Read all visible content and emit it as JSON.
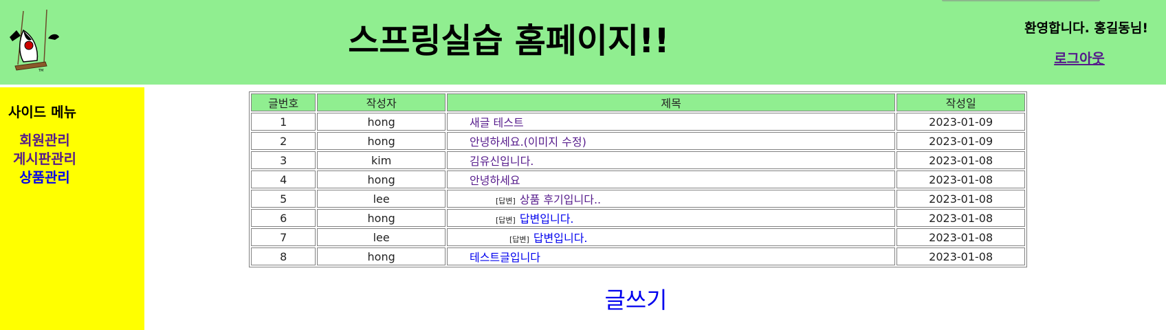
{
  "header": {
    "site_title": "스프링실습 홈페이지!!",
    "welcome_text": "환영합니다. 홍길동님!",
    "logout_label": "로그아웃",
    "logo_icon": "duke-swing-logo"
  },
  "sidebar": {
    "title": "사이드 메뉴",
    "items": [
      {
        "label": "회원관리",
        "color": "#551A8B"
      },
      {
        "label": "게시판관리",
        "color": "#551A8B"
      },
      {
        "label": "상품관리",
        "color": "#0000EE"
      }
    ]
  },
  "board": {
    "columns": [
      "글번호",
      "작성자",
      "제목",
      "작성일"
    ],
    "rows": [
      {
        "no": "1",
        "author": "hong",
        "title": "새글 테스트",
        "reply": "",
        "depth": 0,
        "date": "2023-01-09",
        "visited": true
      },
      {
        "no": "2",
        "author": "hong",
        "title": "안녕하세요.(이미지 수정)",
        "reply": "",
        "depth": 0,
        "date": "2023-01-09",
        "visited": true
      },
      {
        "no": "3",
        "author": "kim",
        "title": "김유신입니다.",
        "reply": "",
        "depth": 0,
        "date": "2023-01-08",
        "visited": true
      },
      {
        "no": "4",
        "author": "hong",
        "title": "안녕하세요",
        "reply": "",
        "depth": 0,
        "date": "2023-01-08",
        "visited": true
      },
      {
        "no": "5",
        "author": "lee",
        "title": "상품 후기입니다..",
        "reply": "[답변]",
        "depth": 1,
        "date": "2023-01-08",
        "visited": true
      },
      {
        "no": "6",
        "author": "hong",
        "title": "답변입니다.",
        "reply": "[답변]",
        "depth": 1,
        "date": "2023-01-08",
        "visited": false
      },
      {
        "no": "7",
        "author": "lee",
        "title": "답변입니다.",
        "reply": "[답변]",
        "depth": 2,
        "date": "2023-01-08",
        "visited": false
      },
      {
        "no": "8",
        "author": "hong",
        "title": "테스트글입니다",
        "reply": "",
        "depth": 0,
        "date": "2023-01-08",
        "visited": false
      }
    ]
  },
  "write_label": "글쓰기",
  "colors": {
    "header_bg": "#90EE90",
    "sidebar_bg": "#FFFF00",
    "visited_link": "#551A8B",
    "link": "#0000EE"
  }
}
